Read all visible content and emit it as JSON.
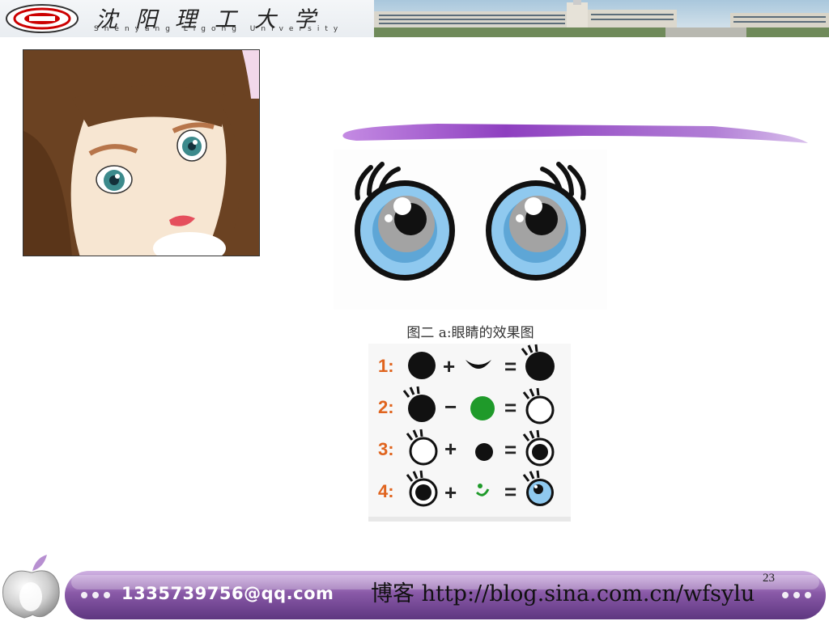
{
  "header": {
    "university_name_cn": "沈阳理工大学",
    "university_name_en": "Shenyang Ligong University"
  },
  "figure": {
    "caption": "图二 a:眼睛的效果图",
    "steps": [
      {
        "label": "1:",
        "op1": "+",
        "op2": "="
      },
      {
        "label": "2:",
        "op1": "−",
        "op2": "="
      },
      {
        "label": "3:",
        "op1": "+",
        "op2": "="
      },
      {
        "label": "4:",
        "op1": "+",
        "op2": "="
      }
    ]
  },
  "footer": {
    "email": "1335739756@qq.com",
    "blog": "博客 http://blog.sina.com.cn/wfsylu",
    "page_number": "23"
  },
  "colors": {
    "footer_bar": "#8a5aa8",
    "step_label": "#e0641e",
    "iris": "#7cc0ea",
    "purple_stroke": "#9b4fc9"
  }
}
